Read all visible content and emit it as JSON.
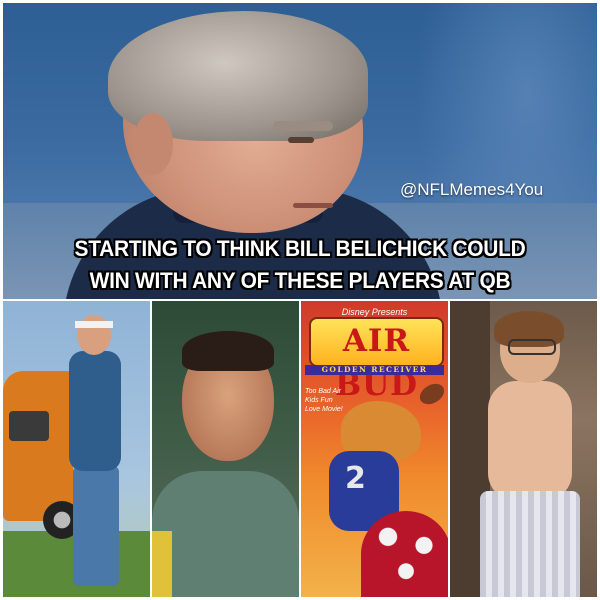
{
  "meme": {
    "watermark": "@NFLMemes4You",
    "caption_line1": "STARTING TO THINK BILL BELICHICK COULD",
    "caption_line2": "WIN WITH ANY OF THESE PLAYERS AT QB"
  },
  "panels": [
    {
      "subject": "man in 1970s outfit holding football next to orange van"
    },
    {
      "subject": "smiling player in green jersey"
    },
    {
      "subject": "Air Bud Golden Receiver movie cover",
      "disney_text": "Disney Presents",
      "title": "AIR BUD",
      "subtitle": "GOLDEN RECEIVER",
      "tagline": "Too Bad Air Kids Fun Love Movie!"
    },
    {
      "subject": "shirtless boy with glasses in boxer shorts"
    }
  ],
  "colors": {
    "caption_text": "#ffffff",
    "caption_outline": "#000000",
    "airbud_title": "#c81818"
  }
}
